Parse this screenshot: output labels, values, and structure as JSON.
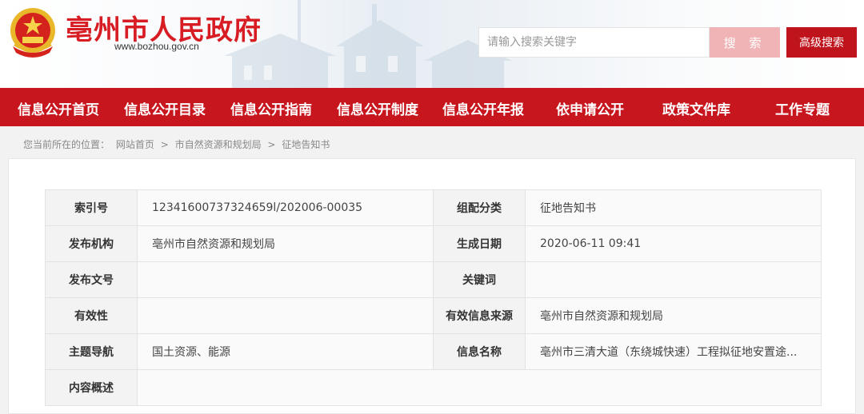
{
  "header": {
    "site_title": "亳州市人民政府",
    "site_url": "www.bozhou.gov.cn",
    "search_placeholder": "请输入搜索关键字",
    "search_button": "搜 索",
    "advanced_search_button": "高级搜索"
  },
  "nav": {
    "items": [
      {
        "label": "信息公开首页"
      },
      {
        "label": "信息公开目录"
      },
      {
        "label": "信息公开指南"
      },
      {
        "label": "信息公开制度"
      },
      {
        "label": "信息公开年报"
      },
      {
        "label": "依申请公开"
      },
      {
        "label": "政策文件库"
      },
      {
        "label": "工作专题"
      }
    ]
  },
  "breadcrumb": {
    "prefix": "您当前所在的位置：",
    "items": [
      "网站首页",
      "市自然资源和规划局",
      "征地告知书"
    ],
    "separator": ">"
  },
  "info_table": {
    "rows": [
      {
        "l_label": "索引号",
        "l_value": "12341600737324659l/202006-00035",
        "r_label": "组配分类",
        "r_value": "征地告知书"
      },
      {
        "l_label": "发布机构",
        "l_value": "亳州市自然资源和规划局",
        "r_label": "生成日期",
        "r_value": "2020-06-11 09:41"
      },
      {
        "l_label": "发布文号",
        "l_value": "",
        "r_label": "关键词",
        "r_value": ""
      },
      {
        "l_label": "有效性",
        "l_value": "",
        "r_label": "有效信息来源",
        "r_value": "亳州市自然资源和规划局"
      },
      {
        "l_label": "主题导航",
        "l_value": "国土资源、能源",
        "r_label": "信息名称",
        "r_value": "亳州市三清大道（东绕城快速）工程拟征地安置途..."
      },
      {
        "l_label": "内容概述",
        "l_value": ""
      }
    ]
  },
  "colors": {
    "brand_red": "#c8161e",
    "title_red": "#d71d23",
    "search_button_pink": "#f1b4b6"
  }
}
